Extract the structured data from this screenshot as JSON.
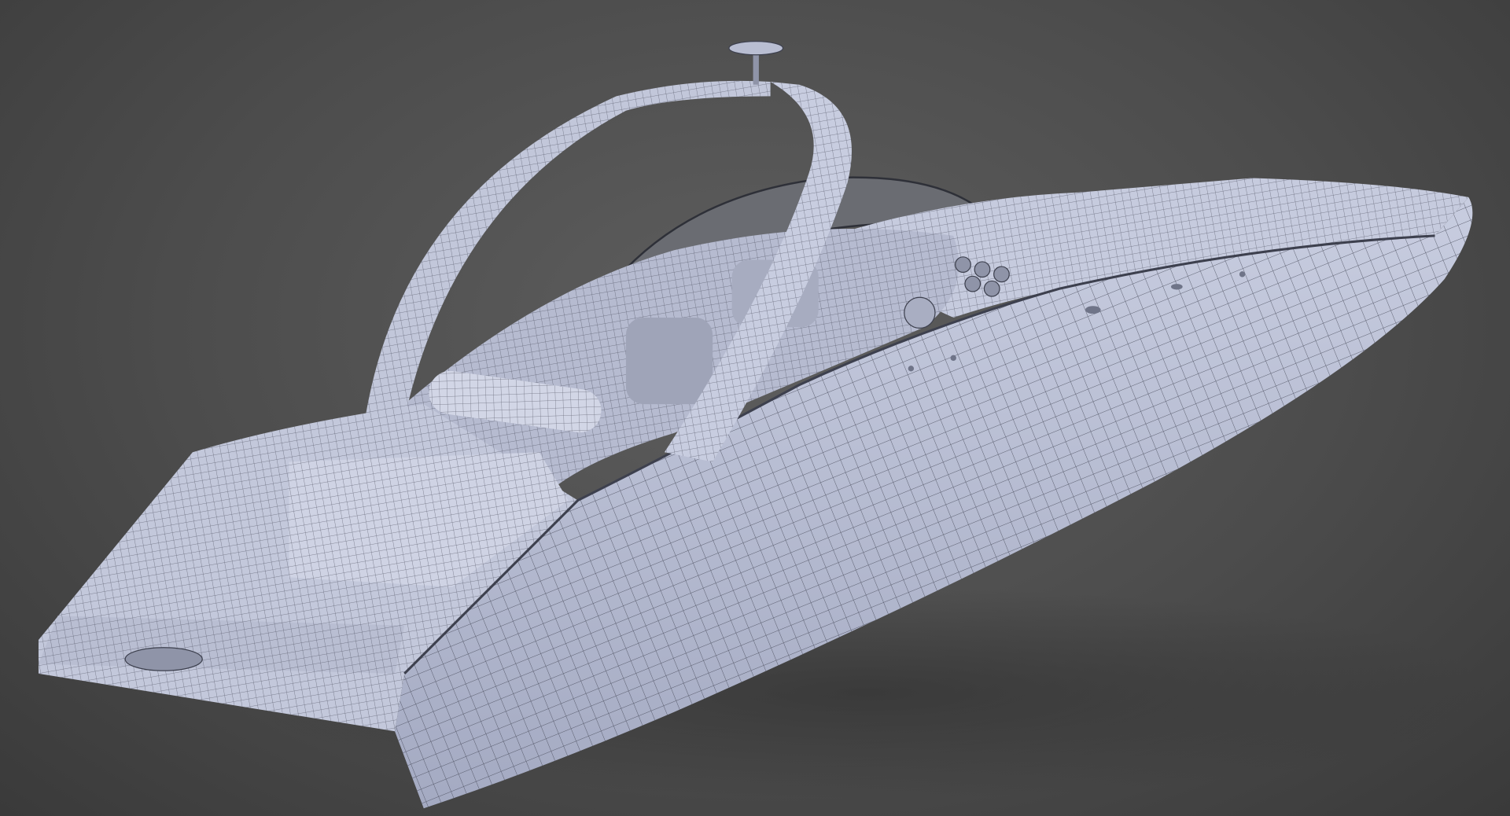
{
  "colors": {
    "background": "#4b4b4b",
    "model": "#c2c7db",
    "model_shadow": "#9ea4bc",
    "wire": "#3d404e",
    "glass": "#6a6c72"
  }
}
